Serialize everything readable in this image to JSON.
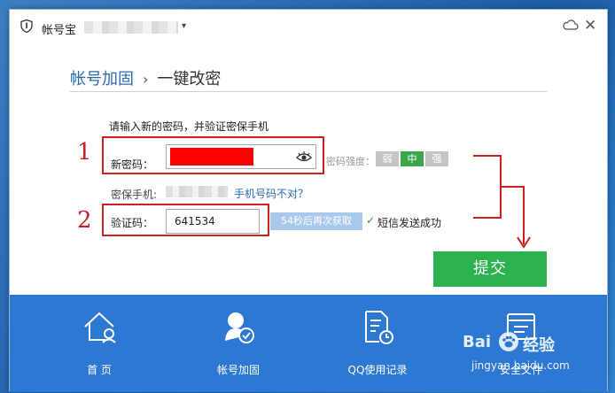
{
  "title_bar": {
    "app_title": "帐号宝",
    "account_caret": "▾",
    "skin_icon": "cloud-icon",
    "close_icon": "close-icon",
    "close_glyph": "✕"
  },
  "breadcrumb": {
    "parent": "帐号加固",
    "separator": "›",
    "current": "一键改密"
  },
  "form": {
    "instruction": "请输入新的密码，并验证密保手机",
    "new_password_label": "新密码：",
    "strength_label": "密码强度：",
    "strength_levels": [
      "弱",
      "中",
      "强"
    ],
    "strength_active": "中",
    "phone_label": "密保手机:",
    "phone_link": "手机号码不对？",
    "code_label": "验证码：",
    "code_value": "641534",
    "resend_button": "54秒后再次获取",
    "send_status": "短信发送成功",
    "submit_button": "提交"
  },
  "annotations": {
    "step_1": "1",
    "step_2": "2"
  },
  "bottom_nav": [
    {
      "label": "首 页",
      "icon": "home-icon"
    },
    {
      "label": "帐号加固",
      "icon": "shield-user-icon"
    },
    {
      "label": "QQ使用记录",
      "icon": "document-clock-icon"
    },
    {
      "label": "安全文件",
      "icon": "safe-file-icon"
    }
  ],
  "watermark": {
    "brand": "Bai",
    "brand_suffix": "经验",
    "url": "jingyan.baidu.com"
  },
  "colors": {
    "accent_blue": "#2d78d3",
    "submit_green": "#2cb34f",
    "annotation_red": "#cc1f1f",
    "redaction_red": "#ff0000"
  }
}
